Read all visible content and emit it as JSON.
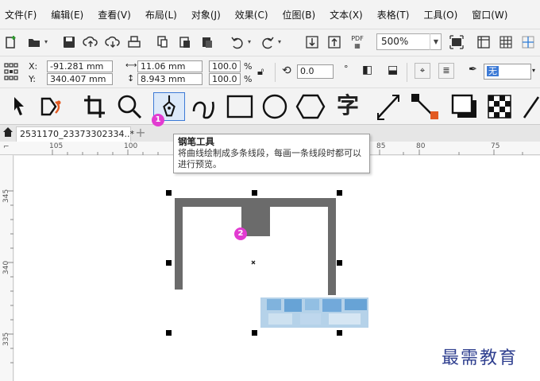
{
  "menu": [
    "文件(F)",
    "编辑(E)",
    "查看(V)",
    "布局(L)",
    "对象(J)",
    "效果(C)",
    "位图(B)",
    "文本(X)",
    "表格(T)",
    "工具(O)",
    "窗口(W)"
  ],
  "standard_toolbar": {
    "zoom_value": "500%",
    "icons": [
      "new-icon",
      "open-icon",
      "save-icon",
      "import-cloud-icon",
      "export-cloud-icon",
      "print-icon",
      "copy-icon",
      "paste-icon",
      "paste-special-icon",
      "undo-icon",
      "redo-icon",
      "import-icon",
      "export-icon",
      "pdf-icon",
      "full-screen-icon",
      "rulers-icon",
      "grid-icon",
      "guidelines-icon"
    ]
  },
  "property_bar": {
    "x_label": "X:",
    "y_label": "Y:",
    "x_value": "-91.281 mm",
    "y_value": "340.407 mm",
    "width_value": "11.06 mm",
    "height_value": "8.943 mm",
    "scale_x": "100.0",
    "scale_y": "100.0",
    "percent": "%",
    "rotation": "0.0",
    "degree": "°",
    "outline_label": "无"
  },
  "toolbox": [
    "pick-tool",
    "shape-tool",
    "crop-tool",
    "zoom-tool",
    "pen-tool",
    "freehand-tool",
    "rectangle-tool",
    "ellipse-tool",
    "polygon-tool",
    "text-tool",
    "dimension-tool",
    "connector-tool",
    "drop-shadow-tool",
    "transparency-tool",
    "eyedropper-tool"
  ],
  "document": {
    "tab_title": "2531170_23373302334..*"
  },
  "rulers": {
    "horizontal": [
      "105",
      "100",
      "85",
      "80",
      "75"
    ],
    "vertical": [
      "345",
      "340",
      "335"
    ]
  },
  "tooltip": {
    "title": "钢笔工具",
    "description": "将曲线绘制成多条线段，每画一条线段时都可以进行预览。"
  },
  "badges": [
    "1",
    "2"
  ],
  "watermark": "最需教育",
  "colors": {
    "shape_fill": "#6b6b6b",
    "selection_handle": "#000000",
    "badge": "#e23bd1",
    "tool_highlight": "#dce9f9",
    "watermark": "#2f3f8f"
  }
}
